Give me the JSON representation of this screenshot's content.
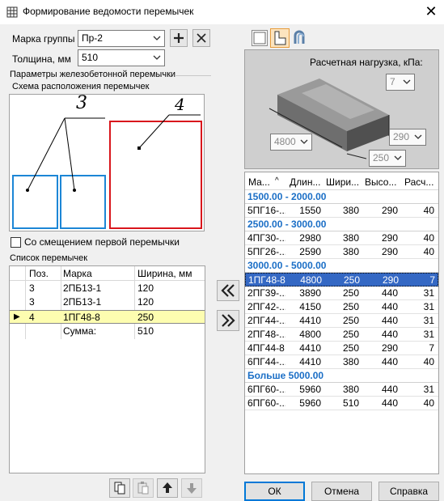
{
  "window": {
    "title": "Формирование ведомости перемычек",
    "close_glyph": "✕"
  },
  "group": {
    "label": "Марка группы",
    "value": "Пр-2"
  },
  "thickness": {
    "label": "Толщина, мм",
    "value": "510"
  },
  "params_group_label": "Параметры железобетонной перемычки",
  "scheme": {
    "label": "Схема расположения перемычек",
    "callout_left": "3",
    "callout_right": "4"
  },
  "offset_checkbox": {
    "label": "Со смещением первой перемычки",
    "checked": false
  },
  "list": {
    "label": "Список перемычек",
    "columns": [
      "Поз.",
      "Марка",
      "Ширина, мм"
    ],
    "rows": [
      {
        "pos": "3",
        "mark": "2ПБ13-1",
        "width": "120",
        "selected": false
      },
      {
        "pos": "3",
        "mark": "2ПБ13-1",
        "width": "120",
        "selected": false
      },
      {
        "pos": "4",
        "mark": "1ПГ48-8",
        "width": "250",
        "selected": true
      }
    ],
    "sum_label": "Сумма:",
    "sum_value": "510"
  },
  "load": {
    "label": "Расчетная нагрузка, кПа:",
    "value": "7"
  },
  "dims": {
    "length": "4800",
    "height": "290",
    "width": "250"
  },
  "catalog": {
    "columns": [
      "Ма...",
      "Длин...",
      "Шири...",
      "Высо...",
      "Расч..."
    ],
    "groups": [
      {
        "title": "1500.00 - 2000.00",
        "rows": [
          [
            "5ПГ16-...",
            "1550",
            "380",
            "290",
            "40"
          ]
        ]
      },
      {
        "title": "2500.00 - 3000.00",
        "rows": [
          [
            "4ПГ30-...",
            "2980",
            "380",
            "290",
            "40"
          ],
          [
            "5ПГ26-...",
            "2590",
            "380",
            "290",
            "40"
          ]
        ]
      },
      {
        "title": "3000.00 - 5000.00",
        "rows": [
          [
            "1ПГ48-8",
            "4800",
            "250",
            "290",
            "7"
          ],
          [
            "2ПГ39-...",
            "3890",
            "250",
            "440",
            "31"
          ],
          [
            "2ПГ42-...",
            "4150",
            "250",
            "440",
            "31"
          ],
          [
            "2ПГ44-...",
            "4410",
            "250",
            "440",
            "31"
          ],
          [
            "2ПГ48-...",
            "4800",
            "250",
            "440",
            "31"
          ],
          [
            "4ПГ44-8",
            "4410",
            "250",
            "290",
            "7"
          ],
          [
            "6ПГ44-...",
            "4410",
            "380",
            "440",
            "40"
          ]
        ]
      },
      {
        "title": "Больше 5000.00",
        "rows": [
          [
            "6ПГ60-...",
            "5960",
            "380",
            "440",
            "31"
          ],
          [
            "6ПГ60-...",
            "5960",
            "510",
            "440",
            "40"
          ]
        ]
      }
    ],
    "selected_mark": "1ПГ48-8"
  },
  "buttons": {
    "ok": "ОК",
    "cancel": "Отмена",
    "help": "Справка"
  },
  "colors": {
    "selection": "#3468c4",
    "highlight_row": "#fdfdb0",
    "group_text": "#1a6ec6",
    "frame_blue": "#1c86d6",
    "frame_red": "#d9161c"
  }
}
